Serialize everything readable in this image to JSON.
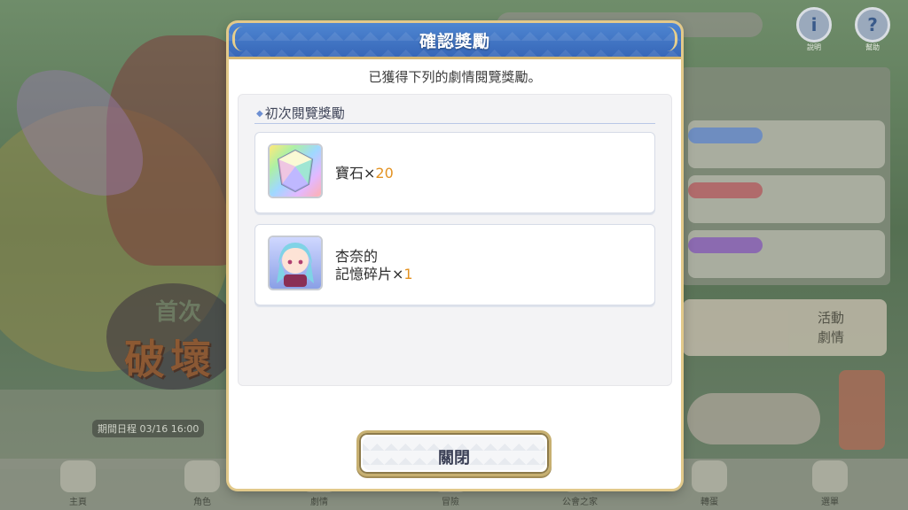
{
  "background": {
    "logo_top": "首次",
    "logo_main": "破壞",
    "date_text": "期間日程 03/16 16:00",
    "top_buttons": [
      {
        "glyph": "i",
        "label": "說明"
      },
      {
        "glyph": "?",
        "label": "幫助"
      }
    ],
    "side_event_label": "活動\n劇情",
    "side_count": "3",
    "bottom_nav": [
      "主頁",
      "角色",
      "劇情",
      "冒險",
      "公會之家",
      "轉蛋",
      "選單"
    ]
  },
  "dialog": {
    "title": "確認獎勵",
    "subtitle": "已獲得下列的劇情閱覽獎勵。",
    "section_title": "初次閱覽獎勵",
    "items": [
      {
        "name": "寶石×",
        "qty": "20",
        "icon": "rainbow-gem-icon"
      },
      {
        "name_line1": "杏奈的",
        "name_line2": "記憶碎片×",
        "qty": "1",
        "icon": "character-memory-piece-icon"
      }
    ],
    "close_label": "關閉"
  },
  "colors": {
    "header_blue": "#3767b8",
    "gold_border": "#d5b772",
    "qty_orange": "#e39222"
  }
}
